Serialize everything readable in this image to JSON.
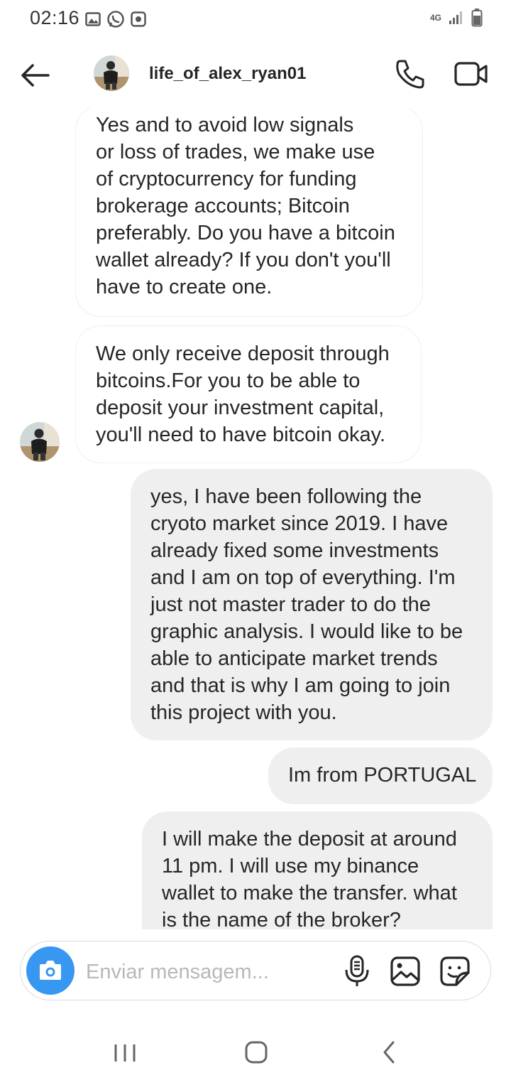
{
  "status_bar": {
    "time": "02:16",
    "network": "4G"
  },
  "header": {
    "username": "life_of_alex_ryan01"
  },
  "messages": [
    {
      "direction": "in",
      "text": "Yes and to avoid low signals\nor loss of trades, we make use\nof cryptocurrency for funding\nbrokerage accounts; Bitcoin\npreferably. Do you have a bitcoin\nwallet already? If you don't you'll\nhave to create one."
    },
    {
      "direction": "in",
      "text": "We only receive deposit through\nbitcoins.For you to be able to\ndeposit your investment capital,\nyou'll need to have bitcoin okay."
    },
    {
      "direction": "out",
      "text": "yes, I have been following the\ncryoto market since 2019. I have\nalready fixed some investments\nand I am on top of everything. I'm\njust not master trader to do the\ngraphic analysis. I would like to be\nable to anticipate market trends\nand that is why I am going to join\nthis project with you."
    },
    {
      "direction": "out",
      "text": "Im from PORTUGAL"
    },
    {
      "direction": "out",
      "text": "I will make the deposit at around\n11 pm. I will use my binance\nwallet to make the transfer. what\nis the name of the broker?"
    }
  ],
  "composer": {
    "placeholder": "Enviar mensagem..."
  },
  "colors": {
    "accent": "#3897f0",
    "outgoing_bubble": "#efefef",
    "incoming_border": "#efefef",
    "text": "#262626"
  },
  "icons": {
    "back": "arrow-left-icon",
    "call": "phone-icon",
    "video": "video-camera-icon",
    "camera": "camera-icon",
    "mic": "microphone-icon",
    "gallery": "image-icon",
    "sticker": "sticker-icon"
  }
}
